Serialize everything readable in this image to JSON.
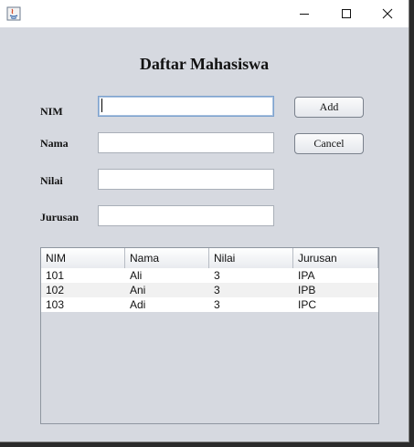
{
  "window": {
    "icon": "java-icon",
    "controls": {
      "minimize": "minimize-icon",
      "maximize": "maximize-icon",
      "close": "close-icon"
    }
  },
  "form": {
    "title": "Daftar Mahasiswa",
    "fields": [
      {
        "label": "NIM",
        "value": ""
      },
      {
        "label": "Nama",
        "value": ""
      },
      {
        "label": "Nilai",
        "value": ""
      },
      {
        "label": "Jurusan",
        "value": ""
      }
    ],
    "buttons": {
      "add": "Add",
      "cancel": "Cancel"
    }
  },
  "table": {
    "columns": [
      "NIM",
      "Nama",
      "Nilai",
      "Jurusan"
    ],
    "rows": [
      [
        "101",
        "Ali",
        "3",
        "IPA"
      ],
      [
        "102",
        "Ani",
        "3",
        "IPB"
      ],
      [
        "103",
        "Adi",
        "3",
        "IPC"
      ]
    ]
  }
}
